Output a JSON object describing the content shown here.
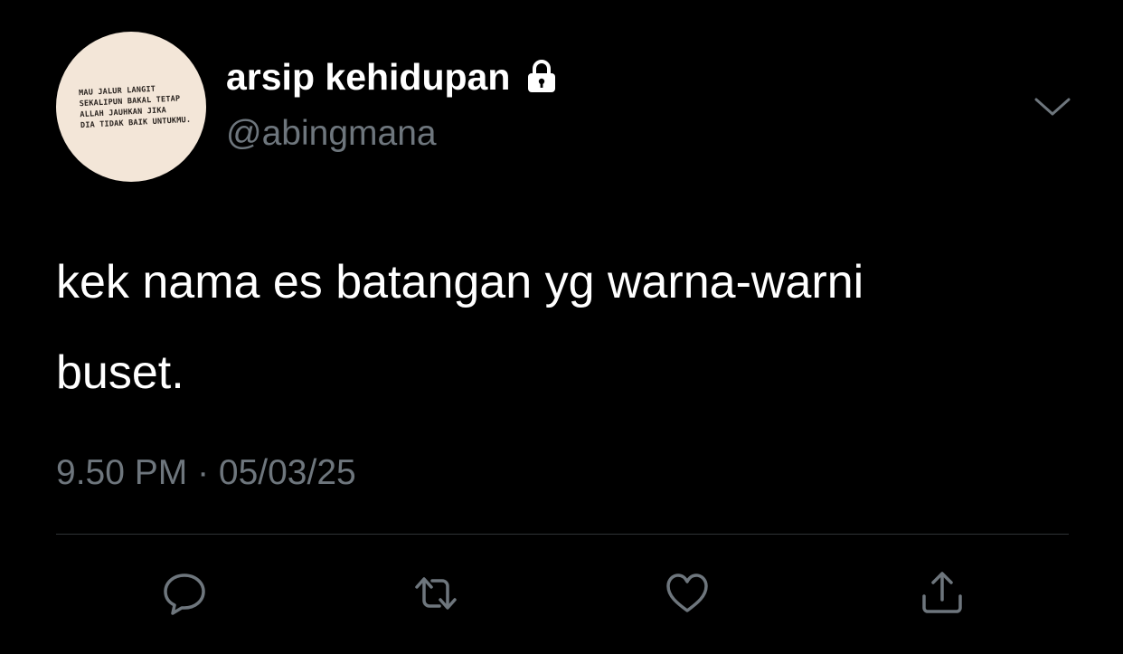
{
  "tweet": {
    "display_name": "arsip kehidupan",
    "handle": "@abingmana",
    "avatar_text": [
      "MAU JALUR LANGIT",
      "SEKALIPUN BAKAL TETAP",
      "ALLAH JAUHKAN JIKA",
      "DIA TIDAK BAIK UNTUKMU."
    ],
    "text_lines": [
      "kek nama es batangan yg warna-warni",
      "buset."
    ],
    "timestamp": "9.50 PM · 05/03/25",
    "locked": true
  },
  "icons": {
    "lock": "lock-icon",
    "more": "chevron-down-icon",
    "reply": "reply-icon",
    "retweet": "retweet-icon",
    "like": "heart-icon",
    "share": "share-icon"
  },
  "colors": {
    "background": "#000000",
    "primary_text": "#ffffff",
    "secondary_text": "#6e767d",
    "divider": "#2f3336",
    "icon": "#6e767d",
    "avatar_bg": "#f3e6d8"
  }
}
